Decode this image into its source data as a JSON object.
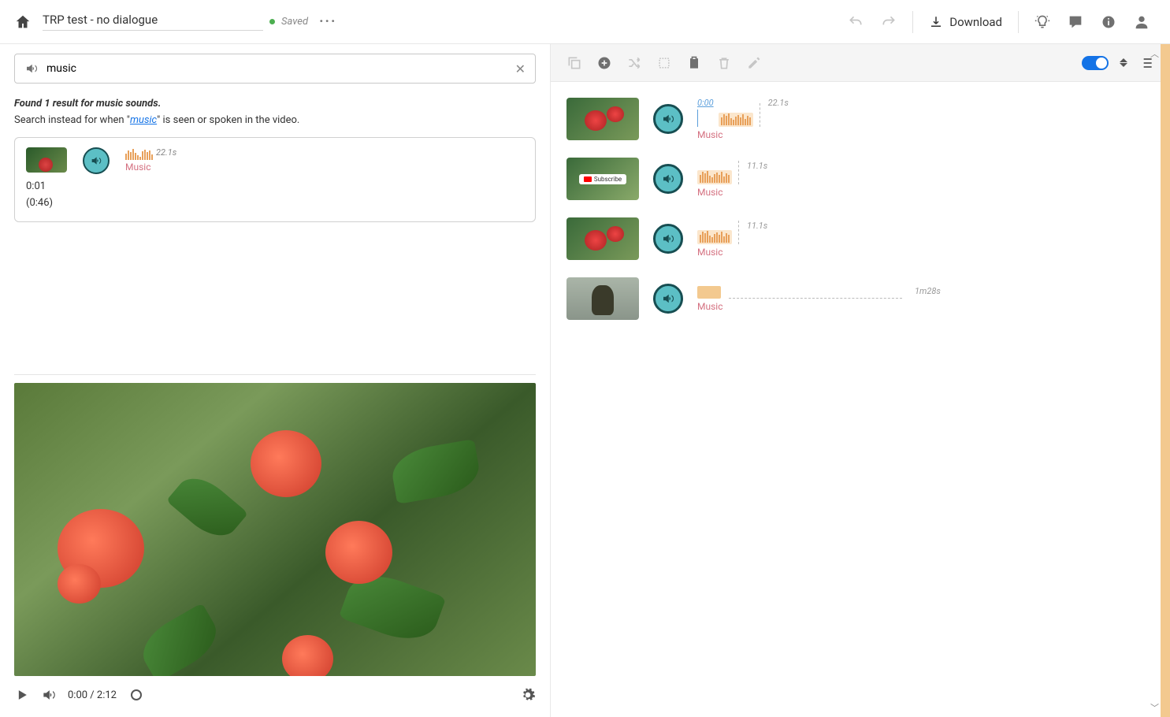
{
  "header": {
    "project_title": "TRP test - no dialogue",
    "saved_label": "Saved",
    "download_label": "Download"
  },
  "search": {
    "value": "music",
    "results_prefix": "Found 1 result for ",
    "results_term": "music sounds",
    "results_suffix": ".",
    "instead_prefix": "Search instead for when \"",
    "instead_link": "music",
    "instead_suffix": "\" is seen or spoken in the video."
  },
  "result": {
    "duration": "22.1s",
    "label": "Music",
    "start": "0:01",
    "length": "(0:46)"
  },
  "player": {
    "current": "0:00",
    "total": "2:12"
  },
  "clips": [
    {
      "playhead": "0:00",
      "duration": "22.1s",
      "label": "Music",
      "thumb": "flowers",
      "wave": true
    },
    {
      "playhead": "",
      "duration": "11.1s",
      "label": "Music",
      "thumb": "subscribe",
      "wave": true
    },
    {
      "playhead": "",
      "duration": "11.1s",
      "label": "Music",
      "thumb": "flowers",
      "wave": true
    },
    {
      "playhead": "",
      "duration": "1m28s",
      "label": "Music",
      "thumb": "person",
      "wave": false
    }
  ]
}
